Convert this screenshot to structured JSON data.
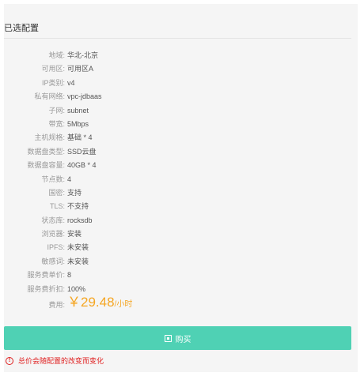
{
  "section_title": "已选配置",
  "config_rows": [
    {
      "label": "地域:",
      "value": "华北-北京"
    },
    {
      "label": "可用区:",
      "value": "可用区A"
    },
    {
      "label": "IP类别:",
      "value": "v4"
    },
    {
      "label": "私有网络:",
      "value": "vpc-jdbaas"
    },
    {
      "label": "子网:",
      "value": "subnet"
    },
    {
      "label": "带宽:",
      "value": "5Mbps"
    },
    {
      "label": "主机规格:",
      "value": "基础 * 4"
    },
    {
      "label": "数据盘类型:",
      "value": "SSD云盘"
    },
    {
      "label": "数据盘容量:",
      "value": "40GB * 4"
    },
    {
      "label": "节点数:",
      "value": "4"
    },
    {
      "label": "国密:",
      "value": "支持"
    },
    {
      "label": "TLS:",
      "value": "不支持"
    },
    {
      "label": "状态库:",
      "value": "rocksdb"
    },
    {
      "label": "浏览器:",
      "value": "安装"
    },
    {
      "label": "IPFS:",
      "value": "未安装"
    },
    {
      "label": "敏感词:",
      "value": "未安装"
    },
    {
      "label": "服务费单价:",
      "value": "8"
    },
    {
      "label": "服务费折扣:",
      "value": "100%"
    }
  ],
  "price": {
    "label": "费用:",
    "amount": "￥29.48",
    "unit": "/小时"
  },
  "buy_button": {
    "label": "购买",
    "icon": "cart-icon"
  },
  "warning": {
    "icon": "exclamation-circle-icon",
    "text": "总价会随配置的改变而变化"
  },
  "colors": {
    "accent": "#4fd1b4",
    "price": "#f5a623",
    "warning": "#e02020"
  }
}
